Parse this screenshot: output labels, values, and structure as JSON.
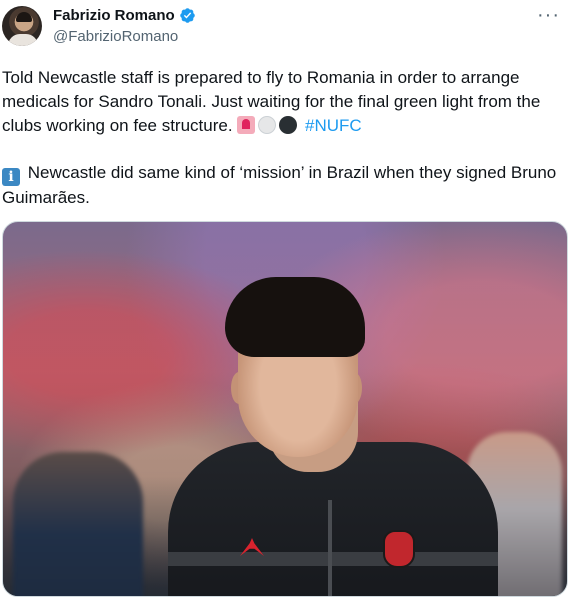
{
  "author": {
    "display_name": "Fabrizio Romano",
    "handle": "@FabrizioRomano"
  },
  "tweet": {
    "text_1": "Told Newcastle staff is prepared to fly to Romania in order to arrange medicals for Sandro Tonali. Just waiting for the final green light from the clubs working on fee structure.",
    "emojis_1": [
      "siren-emoji",
      "white-circle-emoji",
      "black-circle-emoji"
    ],
    "hashtag": "#NUFC",
    "text_2": "Newcastle did same kind of ‘mission’ in Brazil when they signed Bruno Guimarães.",
    "emoji_2": "information-emoji",
    "info_glyph": "i"
  },
  "menu": {
    "more_label": "···"
  },
  "colors": {
    "text": "#0f1419",
    "secondary": "#536471",
    "link": "#1d9bf0",
    "verified": "#1d9bf0"
  }
}
